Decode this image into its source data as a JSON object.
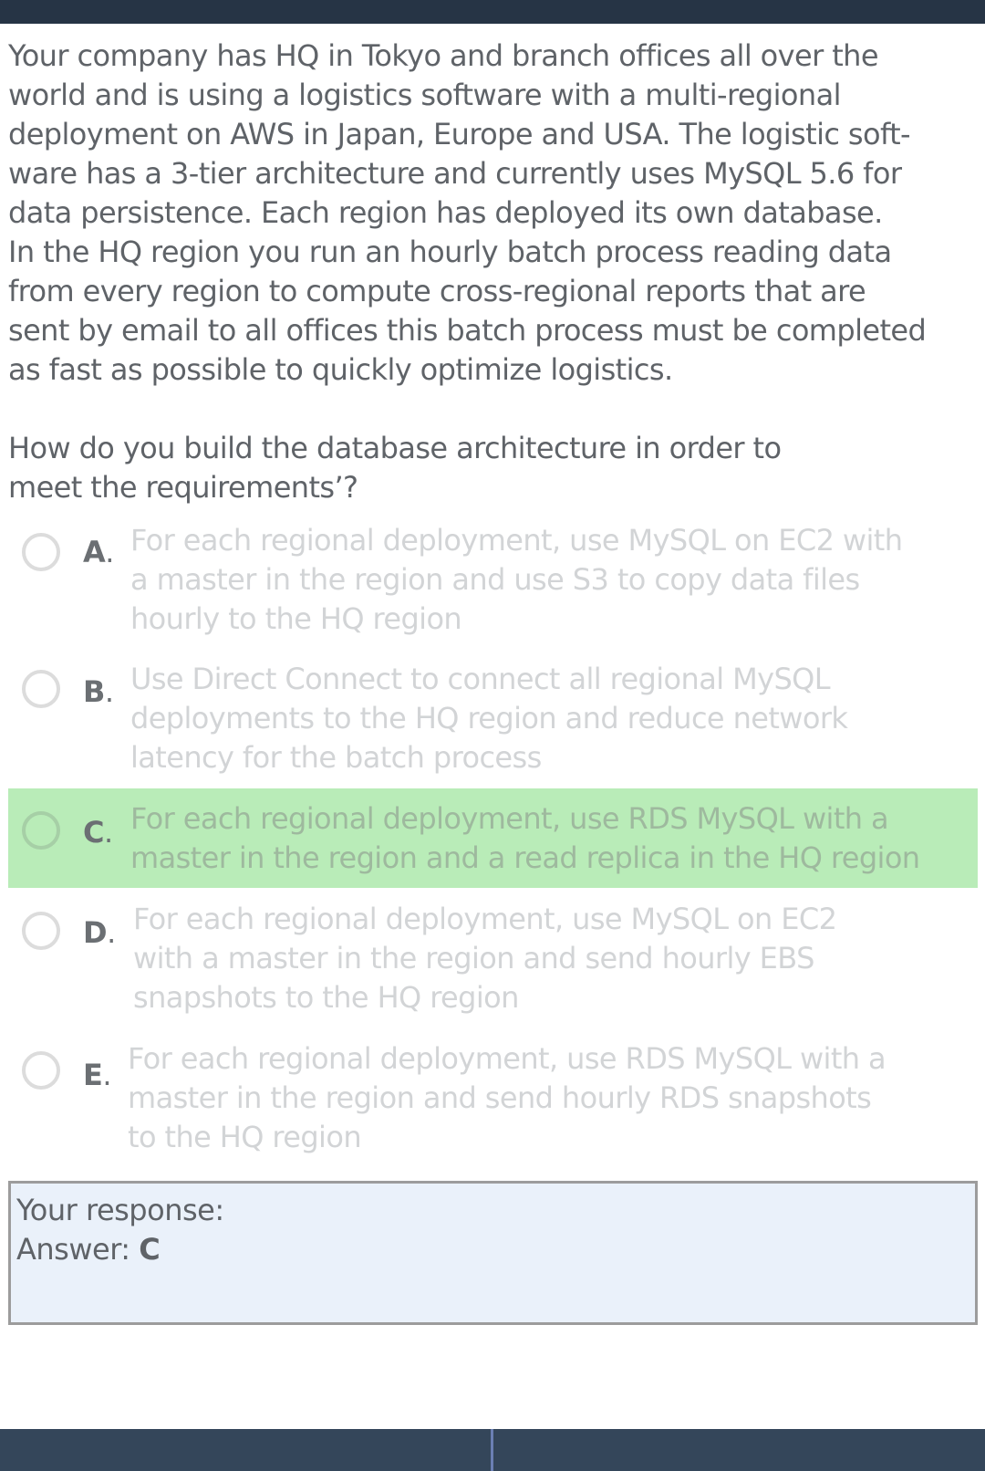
{
  "question": {
    "lines": [
      "Your company has HQ in Tokyo and branch offices all over the",
      "world and is using a logistics software with a multi-regional",
      "deployment on AWS in Japan, Europe and USA. The logistic soft-",
      "ware has a 3-tier architecture and currently uses MySQL 5.6 for",
      "data persistence. Each region has deployed its own database.",
      "In the HQ region you run an hourly batch process reading data",
      "from every region to compute cross-regional reports that are",
      "sent by email to all offices this batch process must be completed",
      "as fast as possible to quickly optimize logistics."
    ],
    "prompt_lines": [
      "How do you build the database architecture in order to",
      "meet the requirements’?"
    ]
  },
  "options": [
    {
      "letter": "A",
      "lines": [
        "For each regional deployment, use MySQL on EC2 with",
        "a master in the region and use S3 to copy data files",
        "hourly to the HQ region"
      ],
      "selected": false,
      "correct": false
    },
    {
      "letter": "B",
      "lines": [
        "Use Direct Connect to connect all regional MySQL",
        "deployments to the HQ region and reduce network",
        "latency for the batch process"
      ],
      "selected": false,
      "correct": false
    },
    {
      "letter": "C",
      "lines": [
        "For each regional deployment, use RDS MySQL with a",
        "master in the region and a read replica in the HQ region"
      ],
      "selected": false,
      "correct": true
    },
    {
      "letter": "D",
      "lines": [
        "For each regional deployment, use MySQL on EC2",
        "with a master in the region and send hourly EBS",
        "snapshots to the HQ region"
      ],
      "selected": false,
      "correct": false
    },
    {
      "letter": "E",
      "lines": [
        "For each regional deployment, use RDS MySQL with a",
        "master in the region and send hourly RDS snapshots",
        "to the HQ region"
      ],
      "selected": false,
      "correct": false
    }
  ],
  "response": {
    "label": "Your response:",
    "answer_label": "Answer: ",
    "answer_value": "C"
  },
  "colors": {
    "topbar": "#263445",
    "bottombar": "#34465a",
    "correct_highlight": "#b9ecb8",
    "response_bg": "#eaf1fa"
  }
}
